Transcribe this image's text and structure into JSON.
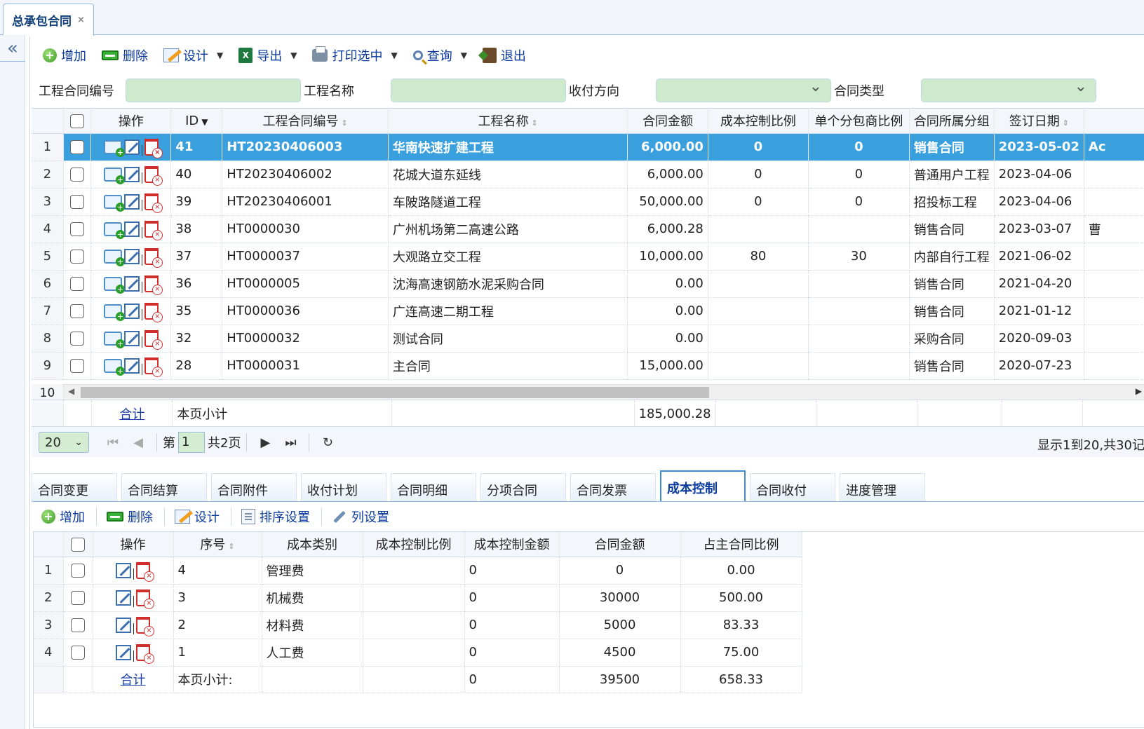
{
  "tab": {
    "title": "总承包合同",
    "close": "×"
  },
  "collapse_glyph": "«",
  "toolbar": {
    "add": "增加",
    "delete": "删除",
    "design": "设计",
    "export": "导出",
    "print": "打印选中",
    "query": "查询",
    "exit": "退出",
    "excel_glyph": "X"
  },
  "filters": {
    "contract_no": {
      "label": "工程合同编号",
      "value": ""
    },
    "project_name": {
      "label": "工程名称",
      "value": ""
    },
    "direction": {
      "label": "收付方向",
      "value": ""
    },
    "contract_type": {
      "label": "合同类型",
      "value": ""
    }
  },
  "main_grid": {
    "columns": [
      "操作",
      "ID",
      "工程合同编号",
      "工程名称",
      "合同金额",
      "成本控制比例",
      "单个分包商比例",
      "合同所属分组",
      "签订日期",
      ""
    ],
    "rows": [
      {
        "n": "1",
        "id": "41",
        "no": "HT20230406003",
        "name": "华南快速扩建工程",
        "amount": "6,000.00",
        "cost_ratio": "0",
        "sub_ratio": "0",
        "group": "销售合同",
        "date": "2023-05-02",
        "extra": "Ac",
        "selected": true
      },
      {
        "n": "2",
        "id": "40",
        "no": "HT20230406002",
        "name": "花城大道东延线",
        "amount": "6,000.00",
        "cost_ratio": "0",
        "sub_ratio": "0",
        "group": "普通用户工程",
        "date": "2023-04-06",
        "extra": ""
      },
      {
        "n": "3",
        "id": "39",
        "no": "HT20230406001",
        "name": "车陂路隧道工程",
        "amount": "50,000.00",
        "cost_ratio": "0",
        "sub_ratio": "0",
        "group": "招投标工程",
        "date": "2023-04-06",
        "extra": ""
      },
      {
        "n": "4",
        "id": "38",
        "no": "HT0000030",
        "name": "广州机场第二高速公路",
        "amount": "6,000.28",
        "cost_ratio": "",
        "sub_ratio": "",
        "group": "销售合同",
        "date": "2023-03-07",
        "extra": "曹"
      },
      {
        "n": "5",
        "id": "37",
        "no": "HT0000037",
        "name": "大观路立交工程",
        "amount": "10,000.00",
        "cost_ratio": "80",
        "sub_ratio": "30",
        "group": "内部自行工程",
        "date": "2021-06-02",
        "extra": ""
      },
      {
        "n": "6",
        "id": "36",
        "no": "HT0000005",
        "name": "沈海高速钢筋水泥采购合同",
        "amount": "0.00",
        "cost_ratio": "",
        "sub_ratio": "",
        "group": "销售合同",
        "date": "2021-04-20",
        "extra": ""
      },
      {
        "n": "7",
        "id": "35",
        "no": "HT0000036",
        "name": "广连高速二期工程",
        "amount": "0.00",
        "cost_ratio": "",
        "sub_ratio": "",
        "group": "销售合同",
        "date": "2021-01-12",
        "extra": ""
      },
      {
        "n": "8",
        "id": "32",
        "no": "HT0000032",
        "name": "测试合同",
        "amount": "0.00",
        "cost_ratio": "",
        "sub_ratio": "",
        "group": "采购合同",
        "date": "2020-09-03",
        "extra": ""
      },
      {
        "n": "9",
        "id": "28",
        "no": "HT0000031",
        "name": "主合同",
        "amount": "15,000.00",
        "cost_ratio": "",
        "sub_ratio": "",
        "group": "销售合同",
        "date": "2020-07-23",
        "extra": ""
      }
    ],
    "partial_row_number": "10",
    "footer": {
      "total_link": "合计",
      "subtotal_label": "本页小计",
      "subtotal_amount": "185,000.28"
    }
  },
  "pager": {
    "page_size": "20",
    "page_prefix": "第",
    "page": "1",
    "page_total": "共2页",
    "info": "显示1到20,共30记"
  },
  "sub_tabs": [
    "合同变更",
    "合同结算",
    "合同附件",
    "收付计划",
    "合同明细",
    "分项合同",
    "合同发票",
    "成本控制",
    "合同收付",
    "进度管理"
  ],
  "active_sub_tab": "成本控制",
  "sub_toolbar": {
    "add": "增加",
    "delete": "删除",
    "design": "设计",
    "sort": "排序设置",
    "columns": "列设置"
  },
  "cost_grid": {
    "columns": [
      "操作",
      "序号",
      "成本类别",
      "成本控制比例",
      "成本控制金额",
      "合同金额",
      "占主合同比例"
    ],
    "rows": [
      {
        "n": "1",
        "seq": "4",
        "category": "管理费",
        "ratio": "",
        "ctrl_amount": "0",
        "amount": "0",
        "share": "0.00"
      },
      {
        "n": "2",
        "seq": "3",
        "category": "机械费",
        "ratio": "",
        "ctrl_amount": "0",
        "amount": "30000",
        "share": "500.00"
      },
      {
        "n": "3",
        "seq": "2",
        "category": "材料费",
        "ratio": "",
        "ctrl_amount": "0",
        "amount": "5000",
        "share": "83.33"
      },
      {
        "n": "4",
        "seq": "1",
        "category": "人工费",
        "ratio": "",
        "ctrl_amount": "0",
        "amount": "4500",
        "share": "75.00"
      }
    ],
    "footer": {
      "total_link": "合计",
      "subtotal_label": "本页小计:",
      "ctrl_amount": "0",
      "amount": "39500",
      "share": "658.33"
    }
  },
  "colors": {
    "selected_row": "#3aa0dd",
    "link": "#0a3b9c",
    "input_bg": "#cdeacd"
  }
}
